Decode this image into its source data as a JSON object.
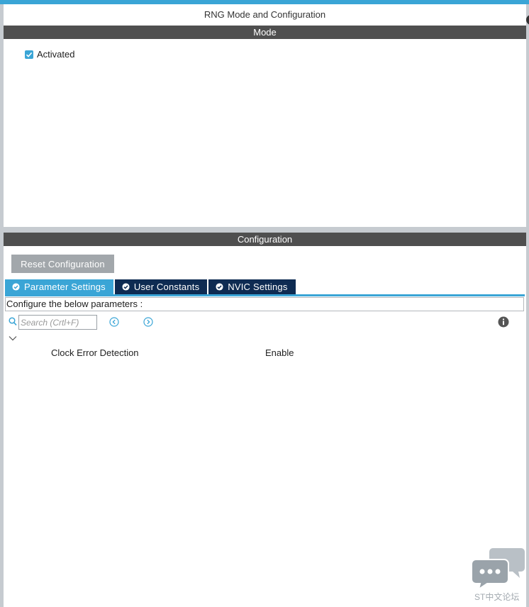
{
  "colors": {
    "accent": "#3aa5d6",
    "dark_tab": "#0e2b52",
    "section_bar": "#4f4f4f",
    "button_gray": "#a2a7ab"
  },
  "mode_panel": {
    "title": "RNG Mode and Configuration",
    "section_label": "Mode",
    "activated": {
      "label": "Activated",
      "checked": true
    }
  },
  "config_panel": {
    "section_label": "Configuration",
    "reset_label": "Reset Configuration",
    "tabs": [
      {
        "label": "Parameter Settings",
        "icon": "check-circle-icon",
        "active": true
      },
      {
        "label": "User Constants",
        "icon": "check-circle-icon",
        "active": false
      },
      {
        "label": "NVIC Settings",
        "icon": "check-circle-icon",
        "active": false
      }
    ],
    "configure_text": "Configure the below parameters :",
    "search": {
      "placeholder": "Search (Crtl+F)",
      "value": ""
    },
    "icons": {
      "search": "search-icon",
      "prev": "chevron-left-circle-icon",
      "next": "chevron-right-circle-icon",
      "info": "info-icon",
      "collapse": "chevron-down-icon"
    },
    "parameters": [
      {
        "name": "Clock Error Detection",
        "value": "Enable"
      }
    ]
  },
  "watermark": {
    "text": "ST中文论坛",
    "icon": "chat-bubbles-icon"
  }
}
